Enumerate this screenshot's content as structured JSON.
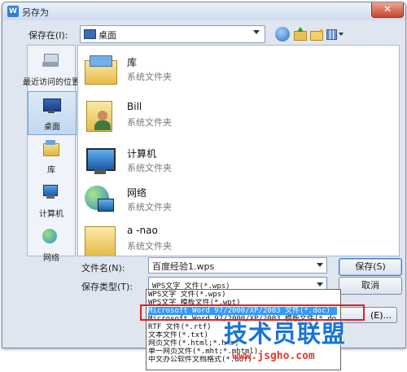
{
  "window": {
    "title": "另存为",
    "app_icon": "W"
  },
  "save_in": {
    "label": "保存在(I):",
    "value": "桌面"
  },
  "toolbar": {
    "icons": [
      "back-icon",
      "up-folder-icon",
      "new-folder-icon",
      "views-menu-icon"
    ]
  },
  "places": [
    {
      "label": "最近访问的位置",
      "icon": "recent-places-icon"
    },
    {
      "label": "桌面",
      "icon": "desktop-icon",
      "selected": true
    },
    {
      "label": "库",
      "icon": "libraries-icon"
    },
    {
      "label": "计算机",
      "icon": "computer-icon"
    },
    {
      "label": "网络",
      "icon": "network-icon"
    }
  ],
  "files": [
    {
      "name": "库",
      "type": "系统文件夹",
      "icon": "libraries-folder-icon"
    },
    {
      "name": "Bill",
      "type": "系统文件夹",
      "icon": "user-folder-icon"
    },
    {
      "name": "计算机",
      "type": "系统文件夹",
      "icon": "computer-icon"
    },
    {
      "name": "网络",
      "type": "系统文件夹",
      "icon": "network-icon"
    },
    {
      "name": "a -nao",
      "type": "系统文件夹",
      "icon": "folder-icon"
    }
  ],
  "filename": {
    "label": "文件名(N):",
    "value": "百度经验1.wps"
  },
  "filetype": {
    "label": "保存类型(T):",
    "value": "WPS文字 文件(*.wps)",
    "options": [
      "WPS文字 文件(*.wps)",
      "WPS文字 模板文件(*.wpt)",
      "Microsoft Word 97/2000/XP/2003 文件(*.doc)",
      "Microsoft Word 97/2000/XP/2003 模板文件(*.dot)",
      "RTF 文件(*.rtf)",
      "文本文件(*.txt)",
      "网页文件(*.html;*.htm)",
      "单一网页文件(*.mht;*.mhtml)",
      "中文办公软件文档格式(*.uof)"
    ],
    "highlighted_index": 2
  },
  "buttons": {
    "save": "保存(S)",
    "cancel": "取消",
    "tools": "(E)..."
  },
  "watermark": {
    "title": "技术员联盟",
    "url": "www.jsgho.com"
  }
}
